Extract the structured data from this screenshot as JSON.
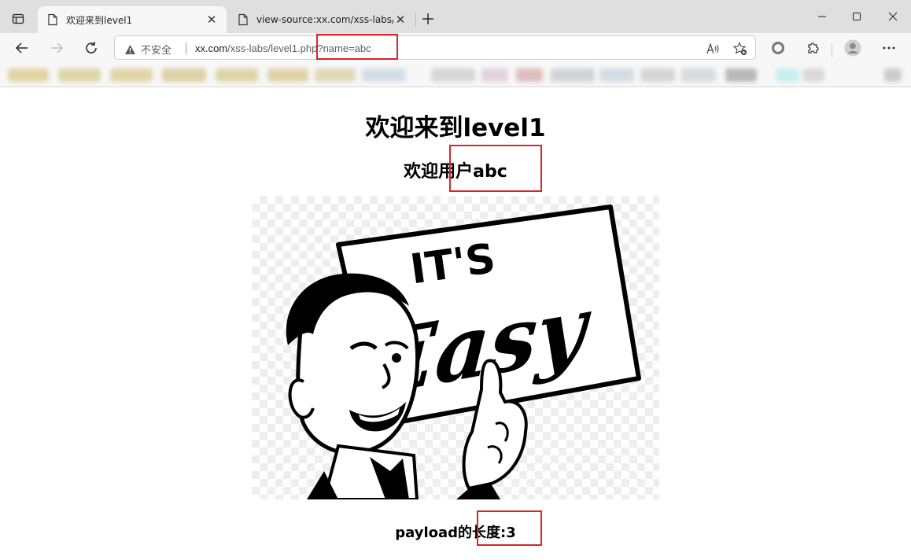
{
  "browser": {
    "tabs": [
      {
        "title": "欢迎来到level1",
        "active": true
      },
      {
        "title": "view-source:xx.com/xss-labs/leve",
        "active": false
      }
    ],
    "address": {
      "security_label": "不安全",
      "url_host": "xx.com",
      "url_path": "/xss-labs/level1.php?name=abc"
    }
  },
  "page": {
    "heading": "欢迎来到level1",
    "welcome_text": "欢迎用户abc",
    "image_text": {
      "line1": "IT'S",
      "line2": "Easy"
    },
    "payload_length_text": "payload的长度:3"
  },
  "colors": {
    "highlight": "#d9242b",
    "tabbar": "#dfdfdf",
    "toolbar": "#f7f7f7"
  }
}
